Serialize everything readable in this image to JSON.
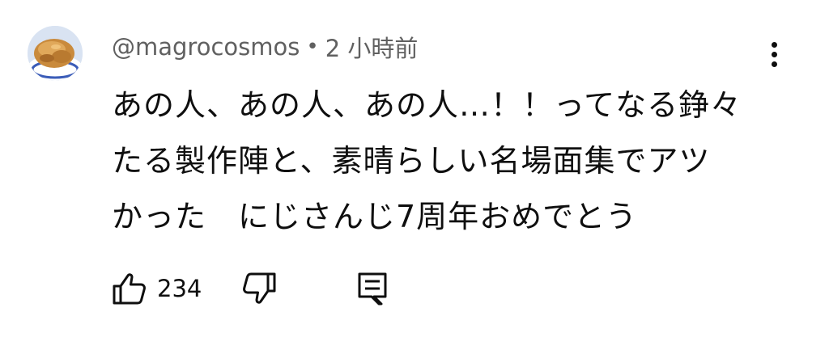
{
  "comment": {
    "author": "@magrocosmos",
    "separator": "•",
    "time": "2 小時前",
    "text": "あの人、あの人、あの人…！！ってなる錚々\nたる製作陣と、素晴らしい名場面集でアツ\nかった　にじさんじ7周年おめでとう",
    "like_count": "234"
  },
  "icons": {
    "avatar": "user-avatar-pastry-photo",
    "menu": "more-vertical-icon",
    "like": "thumbs-up-icon",
    "dislike": "thumbs-down-icon",
    "reply": "reply-comment-icon"
  },
  "colors": {
    "meta_text": "#606060",
    "body_text": "#0f0f0f",
    "background": "#ffffff"
  }
}
